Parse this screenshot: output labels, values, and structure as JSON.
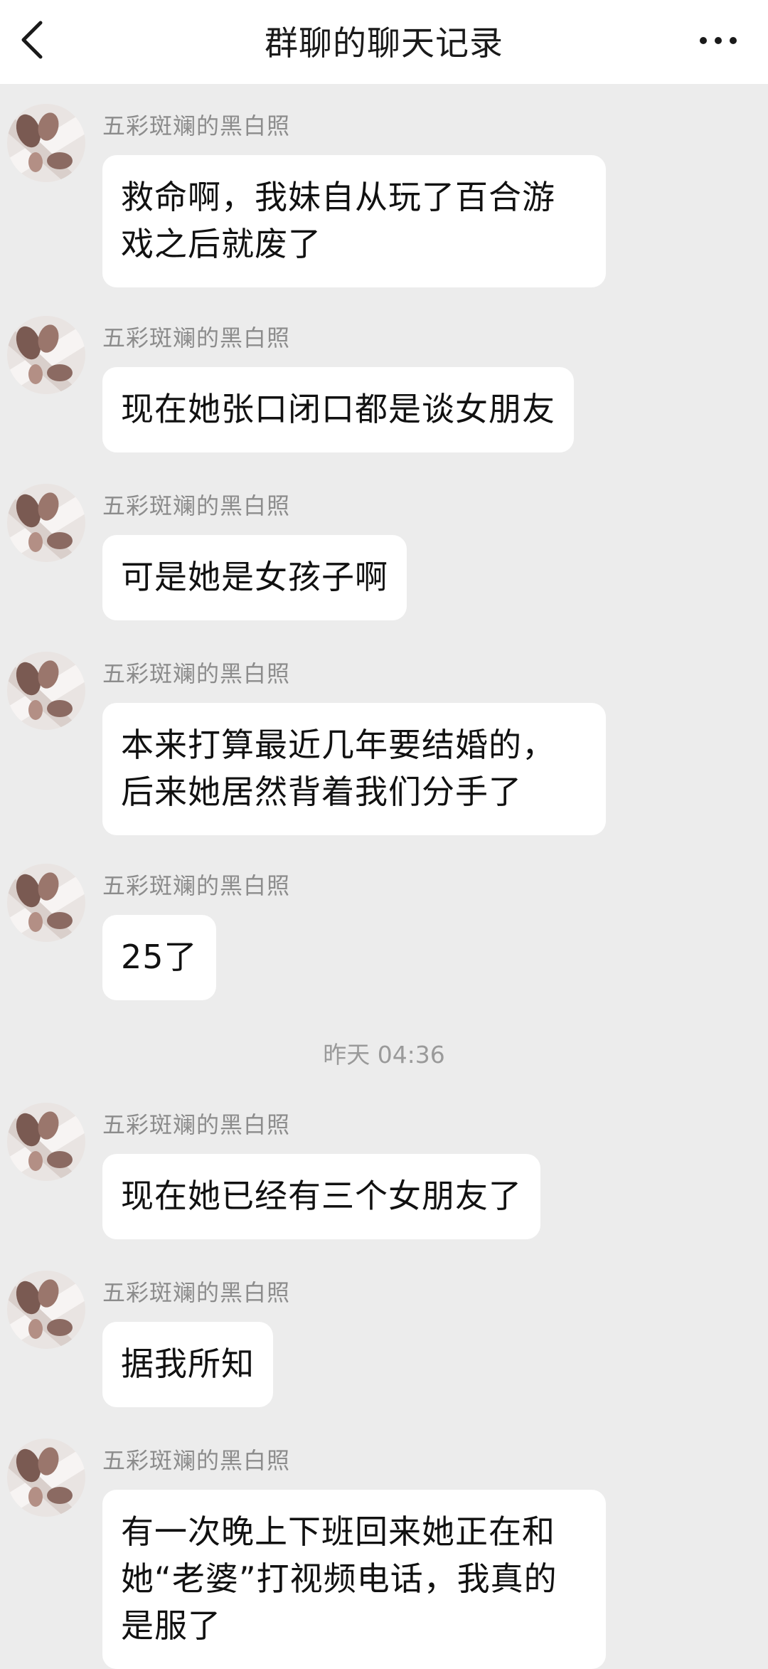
{
  "header": {
    "title": "群聊的聊天记录"
  },
  "messages_part1": [
    {
      "sender": "五彩斑斓的黑白照",
      "text": "救命啊，我妹自从玩了百合游戏之后就废了"
    },
    {
      "sender": "五彩斑斓的黑白照",
      "text": "现在她张口闭口都是谈女朋友"
    },
    {
      "sender": "五彩斑斓的黑白照",
      "text": "可是她是女孩子啊"
    },
    {
      "sender": "五彩斑斓的黑白照",
      "text": "本来打算最近几年要结婚的，后来她居然背着我们分手了"
    },
    {
      "sender": "五彩斑斓的黑白照",
      "text": "25了"
    }
  ],
  "timestamp": "昨天 04:36",
  "messages_part2": [
    {
      "sender": "五彩斑斓的黑白照",
      "text": "现在她已经有三个女朋友了"
    },
    {
      "sender": "五彩斑斓的黑白照",
      "text": "据我所知"
    },
    {
      "sender": "五彩斑斓的黑白照",
      "text": "有一次晚上下班回来她正在和她“老婆”打视频电话，我真的是服了"
    }
  ],
  "icons": {
    "back": "chevron-left-icon",
    "more": "more-horizontal-icon"
  },
  "colors": {
    "background": "#ececec",
    "bubble": "#ffffff",
    "sender": "#8c8c8c"
  }
}
